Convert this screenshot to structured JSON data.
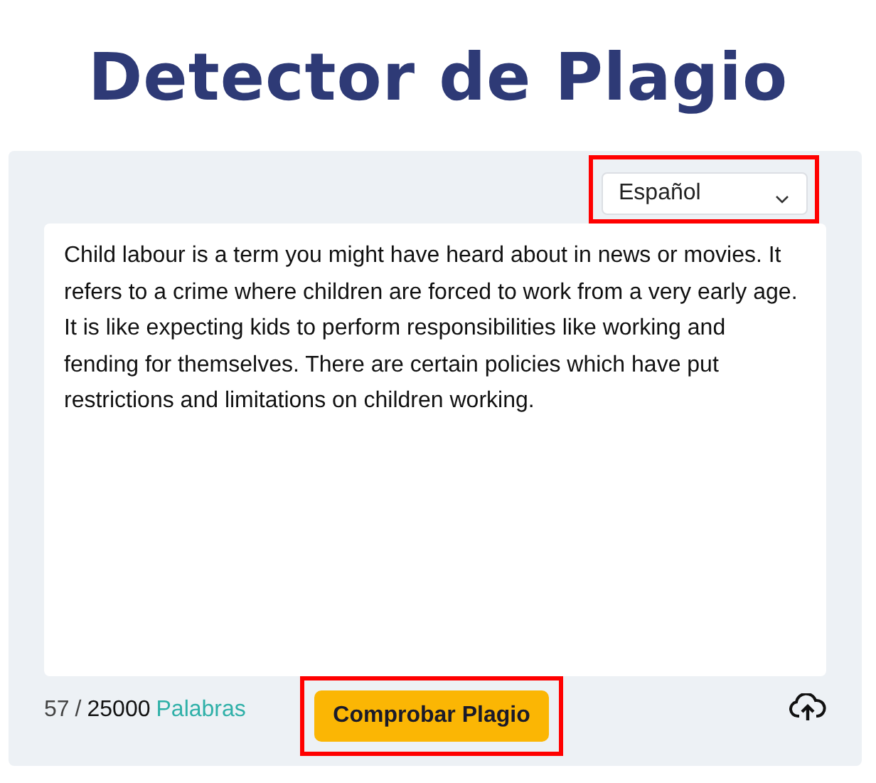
{
  "title": "Detector de Plagio",
  "language_select": {
    "value": "Español"
  },
  "text_field": {
    "value": "Child labour is a term you might have heard about in news or movies. It refers to a crime where children are forced to work from a very early age. It is like expecting kids to perform responsibilities like working and fending for themselves. There are certain policies which have put restrictions and limitations on children working."
  },
  "word_count": {
    "count": "57",
    "separator": "/",
    "limit": "25000",
    "unit": "Palabras"
  },
  "check_button": {
    "label": "Comprobar Plagio"
  }
}
